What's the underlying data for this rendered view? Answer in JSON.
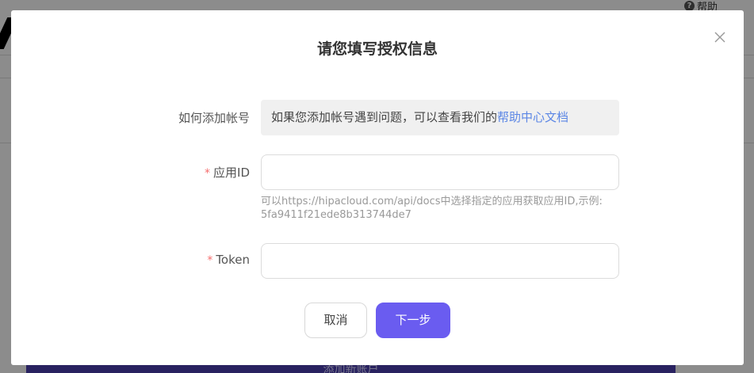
{
  "background": {
    "help_label": "帮助",
    "add_account_button": "添加新账户"
  },
  "modal": {
    "title": "请您填写授权信息",
    "close_icon": "close-icon",
    "how_to": {
      "label": "如何添加帐号",
      "text": "如果您添加帐号遇到问题，可以查看我们的",
      "link": "帮助中心文档"
    },
    "app_id": {
      "required_mark": "*",
      "label": "应用ID",
      "value": "",
      "hint": "可以https://hipacloud.com/api/docs中选择指定的应用获取应用ID,示例: 5fa9411f21ede8b313744de7"
    },
    "token": {
      "required_mark": "*",
      "label": "Token",
      "value": ""
    },
    "cancel_label": "取消",
    "next_label": "下一步"
  },
  "colors": {
    "primary": "#6a5cf0",
    "link": "#5b86e5",
    "required": "#f56c6c"
  }
}
